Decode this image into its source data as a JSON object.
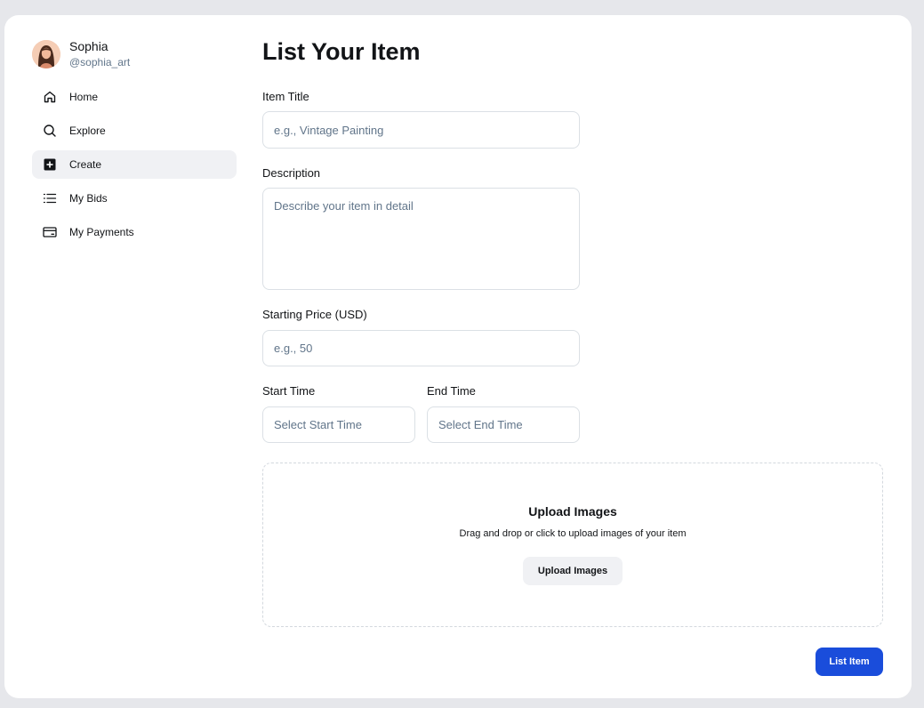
{
  "user": {
    "name": "Sophia",
    "handle": "@sophia_art"
  },
  "nav": {
    "items": [
      {
        "label": "Home",
        "icon": "home-icon"
      },
      {
        "label": "Explore",
        "icon": "search-icon"
      },
      {
        "label": "Create",
        "icon": "plus-square-icon",
        "active": true
      },
      {
        "label": "My Bids",
        "icon": "list-icon"
      },
      {
        "label": "My Payments",
        "icon": "credit-card-icon"
      }
    ]
  },
  "form": {
    "title": "List Your Item",
    "item_title": {
      "label": "Item Title",
      "placeholder": "e.g., Vintage Painting"
    },
    "description": {
      "label": "Description",
      "placeholder": "Describe your item in detail"
    },
    "price": {
      "label": "Starting Price (USD)",
      "placeholder": "e.g., 50"
    },
    "start_time": {
      "label": "Start Time",
      "placeholder": "Select Start Time"
    },
    "end_time": {
      "label": "End Time",
      "placeholder": "Select End Time"
    },
    "upload": {
      "title": "Upload Images",
      "subtitle": "Drag and drop or click to upload images of your item",
      "button": "Upload Images"
    },
    "submit": "List Item"
  },
  "colors": {
    "accent": "#1a4ddb",
    "active_bg": "#f0f1f4",
    "border": "#dbe0e5"
  }
}
